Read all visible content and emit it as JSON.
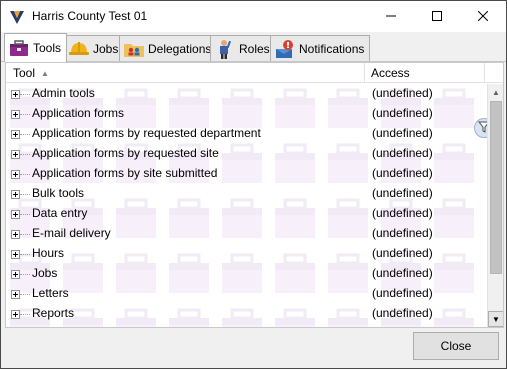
{
  "window": {
    "title": "Harris County Test 01",
    "app_icon": "app-logo-icon",
    "controls": [
      "minimize-icon",
      "maximize-icon",
      "close-icon"
    ]
  },
  "tabs": [
    {
      "label": "Tools",
      "icon": "toolbox-icon",
      "active": true
    },
    {
      "label": "Jobs",
      "icon": "hardhat-icon",
      "active": false
    },
    {
      "label": "Delegations",
      "icon": "folder-users-icon",
      "active": false
    },
    {
      "label": "Roles",
      "icon": "person-roles-icon",
      "active": false
    },
    {
      "label": "Notifications",
      "icon": "notification-bell-icon",
      "active": false
    }
  ],
  "grid": {
    "columns": {
      "tool": "Tool",
      "access": "Access"
    },
    "sort_indicator": "▲",
    "rows": [
      {
        "tool": "Admin tools",
        "access": "(undefined)"
      },
      {
        "tool": "Application forms",
        "access": "(undefined)"
      },
      {
        "tool": "Application forms by requested department",
        "access": "(undefined)"
      },
      {
        "tool": "Application forms by requested site",
        "access": "(undefined)"
      },
      {
        "tool": "Application forms by site submitted",
        "access": "(undefined)"
      },
      {
        "tool": "Bulk tools",
        "access": "(undefined)"
      },
      {
        "tool": "Data entry",
        "access": "(undefined)"
      },
      {
        "tool": "E-mail delivery",
        "access": "(undefined)"
      },
      {
        "tool": "Hours",
        "access": "(undefined)"
      },
      {
        "tool": "Jobs",
        "access": "(undefined)"
      },
      {
        "tool": "Letters",
        "access": "(undefined)"
      },
      {
        "tool": "Reports",
        "access": "(undefined)"
      }
    ],
    "filter_icon": "filter-funnel-icon"
  },
  "buttons": {
    "close": "Close"
  },
  "colors": {
    "active_tab_bg": "#ffffff",
    "grid_border": "#c9c9c9",
    "button_bg": "#e1e1e1"
  }
}
